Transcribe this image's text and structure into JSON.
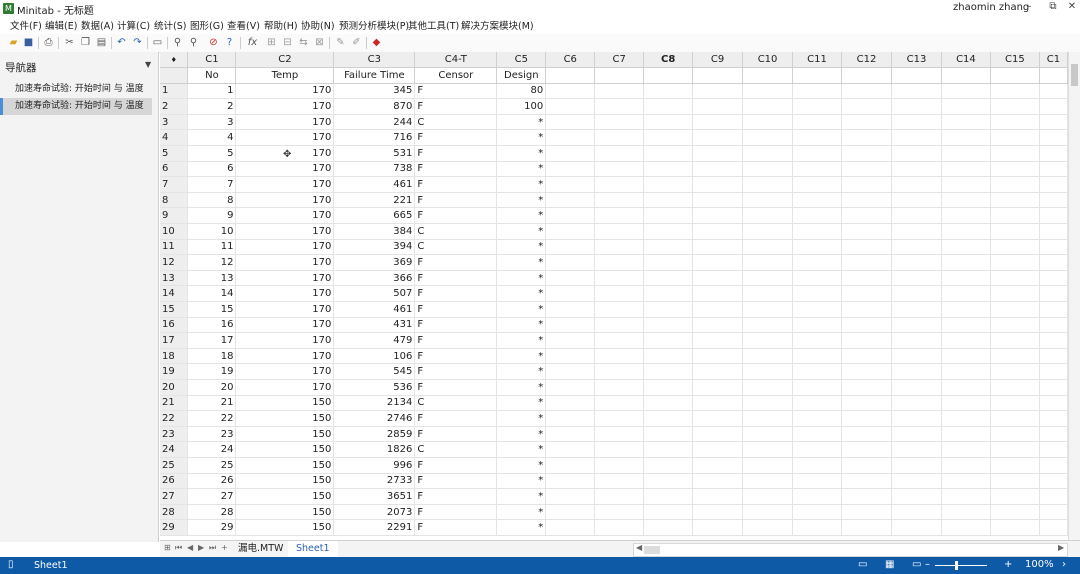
{
  "app": {
    "title": "Minitab - 无标题",
    "user": "zhaomin zhang"
  },
  "menu": [
    "文件(F)",
    "编辑(E)",
    "数据(A)",
    "计算(C)",
    "统计(S)",
    "图形(G)",
    "查看(V)",
    "帮助(H)",
    "协助(N)",
    "预测分析模块(P)",
    "其他工具(T)",
    "解决方案模块(M)"
  ],
  "navigator": {
    "title": "导航器",
    "items": [
      "加速寿命试验: 开始时间 与 温度",
      "加速寿命试验: 开始时间 与 温度"
    ]
  },
  "worksheet": {
    "corner": "♦",
    "columns": [
      "C1",
      "C2",
      "C3",
      "C4-T",
      "C5",
      "C6",
      "C7",
      "C8",
      "C9",
      "C10",
      "C11",
      "C12",
      "C13",
      "C14",
      "C15",
      "C1"
    ],
    "names": [
      "No",
      "Temp",
      "Failure Time",
      "Censor",
      "Design",
      "",
      "",
      "",
      "",
      "",
      "",
      "",
      "",
      "",
      "",
      ""
    ],
    "selected_column": "C8",
    "rows": [
      [
        "1",
        "1",
        "170",
        "345",
        "F",
        "80"
      ],
      [
        "2",
        "2",
        "170",
        "870",
        "F",
        "100"
      ],
      [
        "3",
        "3",
        "170",
        "244",
        "C",
        "*"
      ],
      [
        "4",
        "4",
        "170",
        "716",
        "F",
        "*"
      ],
      [
        "5",
        "5",
        "170",
        "531",
        "F",
        "*"
      ],
      [
        "6",
        "6",
        "170",
        "738",
        "F",
        "*"
      ],
      [
        "7",
        "7",
        "170",
        "461",
        "F",
        "*"
      ],
      [
        "8",
        "8",
        "170",
        "221",
        "F",
        "*"
      ],
      [
        "9",
        "9",
        "170",
        "665",
        "F",
        "*"
      ],
      [
        "10",
        "10",
        "170",
        "384",
        "C",
        "*"
      ],
      [
        "11",
        "11",
        "170",
        "394",
        "C",
        "*"
      ],
      [
        "12",
        "12",
        "170",
        "369",
        "F",
        "*"
      ],
      [
        "13",
        "13",
        "170",
        "366",
        "F",
        "*"
      ],
      [
        "14",
        "14",
        "170",
        "507",
        "F",
        "*"
      ],
      [
        "15",
        "15",
        "170",
        "461",
        "F",
        "*"
      ],
      [
        "16",
        "16",
        "170",
        "431",
        "F",
        "*"
      ],
      [
        "17",
        "17",
        "170",
        "479",
        "F",
        "*"
      ],
      [
        "18",
        "18",
        "170",
        "106",
        "F",
        "*"
      ],
      [
        "19",
        "19",
        "170",
        "545",
        "F",
        "*"
      ],
      [
        "20",
        "20",
        "170",
        "536",
        "F",
        "*"
      ],
      [
        "21",
        "21",
        "150",
        "2134",
        "C",
        "*"
      ],
      [
        "22",
        "22",
        "150",
        "2746",
        "F",
        "*"
      ],
      [
        "23",
        "23",
        "150",
        "2859",
        "F",
        "*"
      ],
      [
        "24",
        "24",
        "150",
        "1826",
        "C",
        "*"
      ],
      [
        "25",
        "25",
        "150",
        "996",
        "F",
        "*"
      ],
      [
        "26",
        "26",
        "150",
        "2733",
        "F",
        "*"
      ],
      [
        "27",
        "27",
        "150",
        "3651",
        "F",
        "*"
      ],
      [
        "28",
        "28",
        "150",
        "2073",
        "F",
        "*"
      ],
      [
        "29",
        "29",
        "150",
        "2291",
        "F",
        "*"
      ]
    ]
  },
  "sheet_tabs": [
    "漏电.MTW",
    "Sheet1"
  ],
  "status": {
    "text": "Sheet1",
    "zoom": "100%"
  },
  "colors": {
    "statusbar": "#0e5aa7",
    "selected_tab": "#2a63b8",
    "nav_selected_border": "#4a8fd6"
  }
}
